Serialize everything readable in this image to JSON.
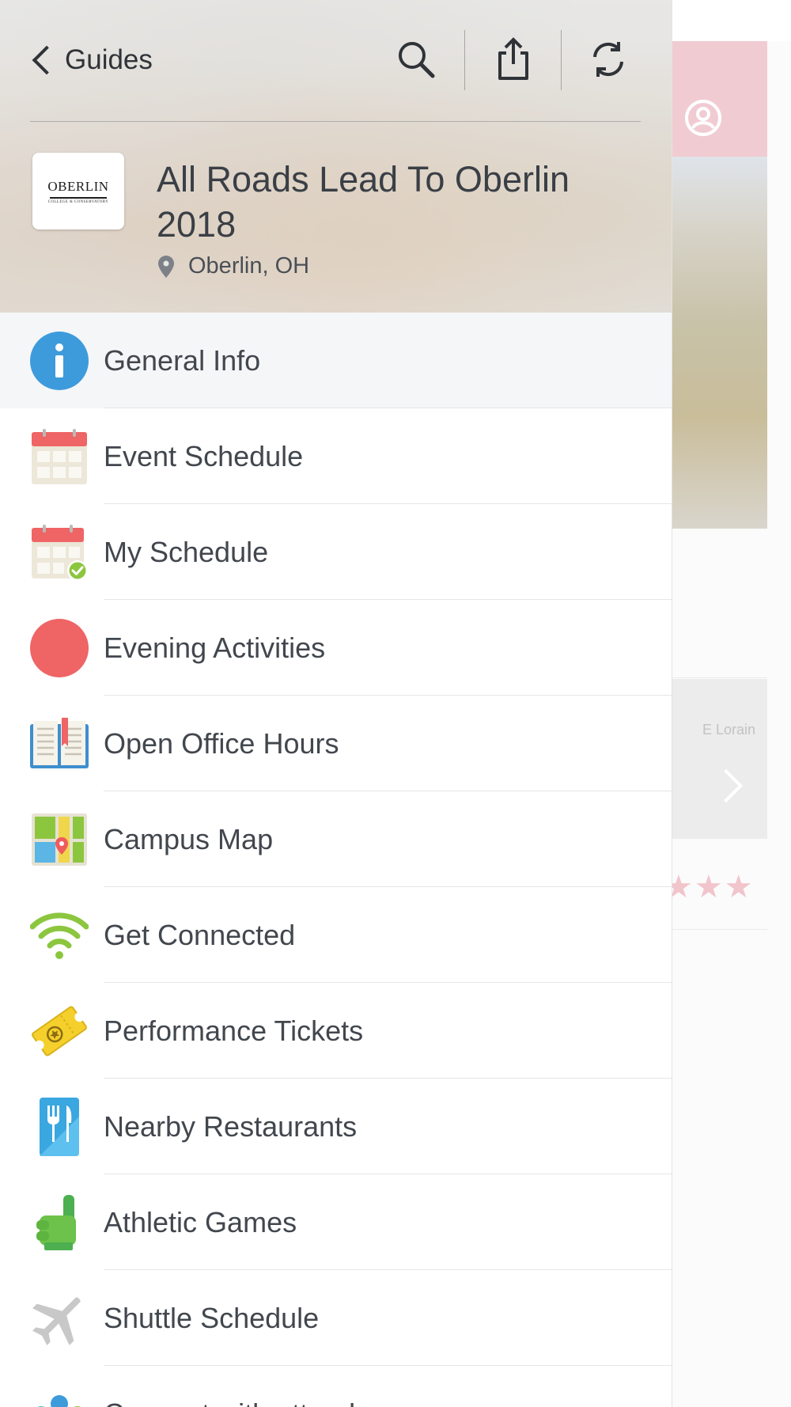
{
  "header": {
    "back_label": "Guides",
    "guide_title": "All Roads Lead To Oberlin 2018",
    "location": "Oberlin, OH",
    "logo_text": "OBERLIN",
    "logo_subtext": "COLLEGE & CONSERVATORY"
  },
  "toolbar": {
    "search_icon": "search-icon",
    "share_icon": "share-icon",
    "refresh_icon": "refresh-icon"
  },
  "menu": {
    "items": [
      {
        "label": "General Info",
        "icon": "info-icon",
        "selected": true
      },
      {
        "label": "Event Schedule",
        "icon": "calendar-icon"
      },
      {
        "label": "My Schedule",
        "icon": "calendar-check-icon"
      },
      {
        "label": "Evening Activities",
        "icon": "red-circle-icon"
      },
      {
        "label": "Open Office Hours",
        "icon": "book-icon"
      },
      {
        "label": "Campus Map",
        "icon": "map-icon"
      },
      {
        "label": "Get Connected",
        "icon": "wifi-icon"
      },
      {
        "label": "Performance Tickets",
        "icon": "ticket-icon"
      },
      {
        "label": "Nearby Restaurants",
        "icon": "restaurant-icon"
      },
      {
        "label": "Athletic Games",
        "icon": "foam-finger-icon"
      },
      {
        "label": "Shuttle Schedule",
        "icon": "airplane-icon"
      },
      {
        "label": "Connect with attendees",
        "icon": "attendees-icon"
      }
    ]
  },
  "background": {
    "map_label": "E Lorain",
    "rating_stars": "★★★"
  },
  "colors": {
    "accent_pink": "#f1cbd2",
    "info_blue": "#3d9bdc",
    "calendar_red": "#ef6465",
    "wifi_green": "#8cc63f",
    "ticket_yellow": "#f5cf2b"
  }
}
